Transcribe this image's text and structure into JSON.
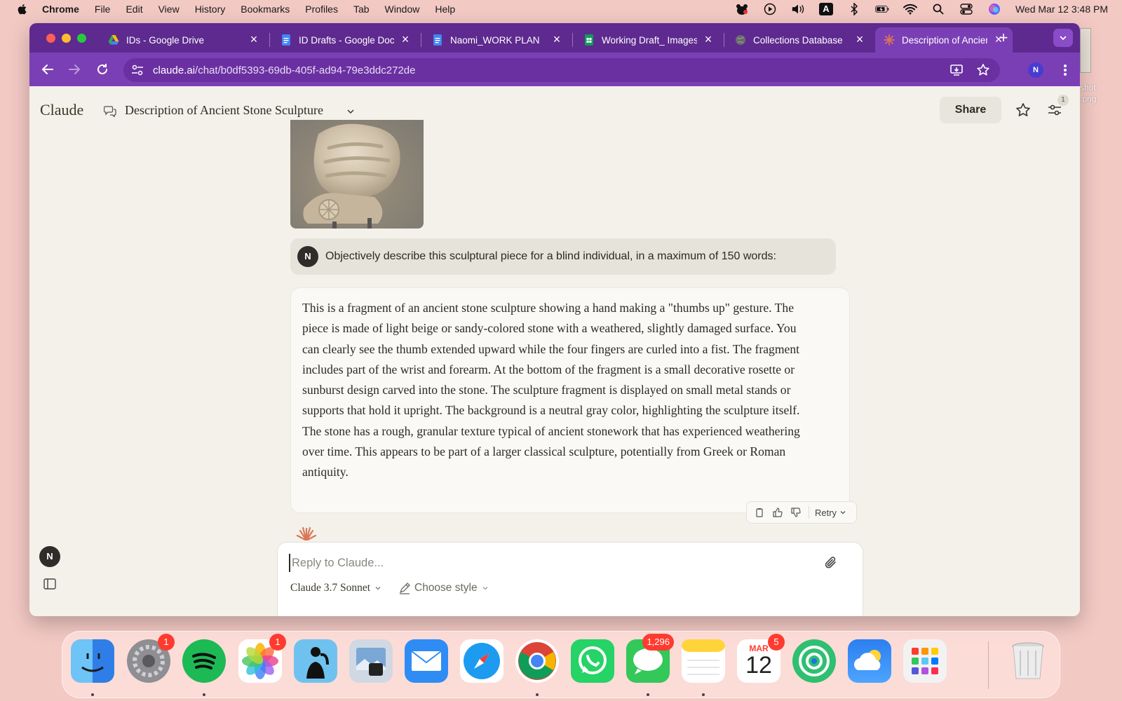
{
  "menubar": {
    "app_name": "Chrome",
    "items": [
      "File",
      "Edit",
      "View",
      "History",
      "Bookmarks",
      "Profiles",
      "Tab",
      "Window",
      "Help"
    ],
    "status_icons": [
      "bear-icon",
      "play-icon",
      "volume-icon",
      "input-source-icon",
      "bluetooth-icon",
      "battery-icon",
      "wifi-icon",
      "spotlight-icon",
      "control-center-icon",
      "siri-icon"
    ],
    "input_source_label": "A",
    "clock": "Wed Mar 12  3:48 PM"
  },
  "desktop_file": {
    "name_line1": "shot",
    "name_line2": ".png"
  },
  "tabs": [
    {
      "title": "IDs - Google Drive",
      "icon": "google-drive-icon"
    },
    {
      "title": "ID Drafts - Google Docs",
      "icon": "google-docs-icon"
    },
    {
      "title": "Naomi_WORK PLAN",
      "icon": "google-docs-icon"
    },
    {
      "title": "Working Draft_ Images",
      "icon": "google-sheets-icon"
    },
    {
      "title": "Collections Database",
      "icon": "globe-icon"
    },
    {
      "title": "Description of Ancient",
      "icon": "claude-icon",
      "active": true
    }
  ],
  "address_bar": {
    "host": "claude.ai",
    "path": "/chat/b0df5393-69db-405f-ad94-79e3ddc272de"
  },
  "profile_initial": "N",
  "claude": {
    "logo": "Claude",
    "chat_title": "Description of Ancient Stone Sculpture",
    "share_label": "Share",
    "settings_badge": "1",
    "user_initial": "N",
    "user_message": "Objectively describe this sculptural piece for a blind individual, in a maximum of 150 words:",
    "assistant_message": "This is a fragment of an ancient stone sculpture showing a hand making a \"thumbs up\" gesture. The piece is made of light beige or sandy-colored stone with a weathered, slightly damaged surface. You can clearly see the thumb extended upward while the four fingers are curled into a fist. The fragment includes part of the wrist and forearm. At the bottom of the fragment is a small decorative rosette or sunburst design carved into the stone. The sculpture fragment is displayed on small metal stands or supports that hold it upright. The background is a neutral gray color, highlighting the sculpture itself. The stone has a rough, granular texture typical of ancient stonework that has experienced weathering over time. This appears to be part of a larger classical sculpture, potentially from Greek or Roman antiquity.",
    "retry_label": "Retry",
    "composer_placeholder": "Reply to Claude...",
    "model_label": "Claude 3.7 Sonnet",
    "style_label": "Choose style",
    "sidebar_initial": "N"
  },
  "dock": {
    "apps": [
      {
        "name": "Finder",
        "color": "#3b8df0"
      },
      {
        "name": "System Settings",
        "color": "#8e8e93",
        "badge": "1"
      },
      {
        "name": "Spotify",
        "color": "#1db954"
      },
      {
        "name": "Photos",
        "color": "#ffffff",
        "badge": "1"
      },
      {
        "name": "Kindle",
        "color": "#6fc2ef"
      },
      {
        "name": "Preview",
        "color": "#cfd8e3"
      },
      {
        "name": "Mail",
        "color": "#2f8cf5"
      },
      {
        "name": "Safari",
        "color": "#1d9bf0"
      },
      {
        "name": "Chrome",
        "color": "#ffffff"
      },
      {
        "name": "WhatsApp",
        "color": "#25d366"
      },
      {
        "name": "Messages",
        "color": "#34c759",
        "badge": "1,296"
      },
      {
        "name": "Notes",
        "color": "#ffd43b"
      },
      {
        "name": "Calendar",
        "color": "#ffffff",
        "badge": "5",
        "month": "MAR",
        "day": "12"
      },
      {
        "name": "Find My",
        "color": "#2fbf71"
      },
      {
        "name": "Weather",
        "color": "#2b7ff0"
      },
      {
        "name": "Launchpad",
        "color": "#f2f2f2"
      },
      {
        "name": "Trash",
        "color": "#e8e8e8"
      }
    ]
  }
}
